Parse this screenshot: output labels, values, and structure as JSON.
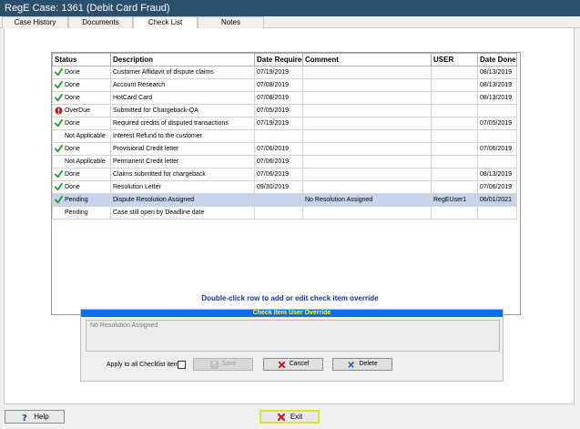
{
  "window": {
    "title": "RegE Case: 1361 (Debit Card Fraud)"
  },
  "tabs": [
    {
      "label": "Case History"
    },
    {
      "label": "Documents"
    },
    {
      "label": "Check List",
      "active": true
    },
    {
      "label": "Notes"
    }
  ],
  "grid": {
    "columns": [
      "Status",
      "Description",
      "Date Required",
      "Comment",
      "USER",
      "Date Done"
    ],
    "rows": [
      {
        "status_icon": "check-icon",
        "status": "Done",
        "description": "Customer Affidavit of dispute claims",
        "date_required": "07/19/2019",
        "comment": "",
        "user": "",
        "date_done": "08/13/2019"
      },
      {
        "status_icon": "check-icon",
        "status": "Done",
        "description": "Account Research",
        "date_required": "07/08/2019",
        "comment": "",
        "user": "",
        "date_done": "08/13/2019"
      },
      {
        "status_icon": "check-icon",
        "status": "Done",
        "description": "HotCard Card",
        "date_required": "07/08/2019",
        "comment": "",
        "user": "",
        "date_done": "08/13/2019"
      },
      {
        "status_icon": "overdue-icon",
        "status": "OverDue",
        "description": "Submitted for Chargeback-QA",
        "date_required": "07/05/2019",
        "comment": "",
        "user": "",
        "date_done": ""
      },
      {
        "status_icon": "check-icon",
        "status": "Done",
        "description": "Required credits of disputed transactions",
        "date_required": "07/19/2019",
        "comment": "",
        "user": "",
        "date_done": "07/05/2019"
      },
      {
        "status_icon": "",
        "status": "Not Applicable",
        "description": "Interest Refund to the customer",
        "date_required": "",
        "comment": "",
        "user": "",
        "date_done": ""
      },
      {
        "status_icon": "check-icon",
        "status": "Done",
        "description": "Provisional Credit letter",
        "date_required": "07/06/2019",
        "comment": "",
        "user": "",
        "date_done": "07/06/2019"
      },
      {
        "status_icon": "",
        "status": "Not Applicable",
        "description": "Permanent Credit letter",
        "date_required": "07/06/2019",
        "comment": "",
        "user": "",
        "date_done": ""
      },
      {
        "status_icon": "check-icon",
        "status": "Done",
        "description": "Claims submitted for chargeback",
        "date_required": "07/06/2019",
        "comment": "",
        "user": "",
        "date_done": "08/13/2019"
      },
      {
        "status_icon": "check-icon",
        "status": "Done",
        "description": "Resolution Letter",
        "date_required": "09/30/2019",
        "comment": "",
        "user": "",
        "date_done": "07/06/2019"
      },
      {
        "status_icon": "check-icon",
        "status": "Pending",
        "description": "Dispute Resolution Assigned",
        "date_required": "",
        "comment": "No Resolution Assigned",
        "user": "RegEUser1",
        "date_done": "06/01/2021",
        "selected": true
      },
      {
        "status_icon": "",
        "status": "Pending",
        "description": "Case still open by Deadline date",
        "date_required": "",
        "comment": "",
        "user": "",
        "date_done": ""
      }
    ]
  },
  "hint": "Double-click row to add or edit check item override",
  "override": {
    "header": "Check Item User Override",
    "text": "No Resolution Assigned",
    "apply_label": "Apply to all Checklist items",
    "save_label": "Save",
    "cancel_label": "Cancel",
    "delete_label": "Delete"
  },
  "footer": {
    "help_label": "Help",
    "exit_label": "Exit"
  },
  "colors": {
    "title_bar": "#2b4f6e",
    "selected_row": "#c6d3ea",
    "header_blue": "#0a6ee8",
    "hint_blue": "#1f2fb3"
  }
}
